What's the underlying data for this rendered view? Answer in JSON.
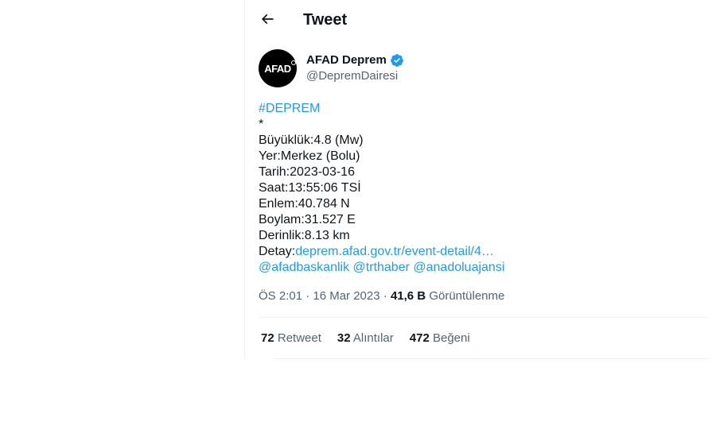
{
  "header": {
    "title": "Tweet",
    "back_icon": "arrow-left-icon"
  },
  "author": {
    "avatar_text": "AFAD",
    "name": "AFAD Deprem",
    "handle": "@DepremDairesi",
    "verified_icon": "verified-badge-icon",
    "verified_color": "#1d9bf0"
  },
  "tweet": {
    "hashtag": "#DEPREM",
    "star": "*",
    "magnitude": "Büyüklük:4.8 (Mw)",
    "location": "Yer:Merkez (Bolu)",
    "date": "Tarih:2023-03-16",
    "time": "Saat:13:55:06 TSİ",
    "latitude": "Enlem:40.784 N",
    "longitude": "Boylam:31.527 E",
    "depth": "Derinlik:8.13 km",
    "detail_label": "Detay:",
    "detail_link": "deprem.afad.gov.tr/event-detail/4…",
    "mentions": [
      "@afadbaskanlik",
      "@trthaber",
      "@anadoluajansi"
    ],
    "link_color": "#1d9bf0"
  },
  "meta": {
    "timestamp": "ÖS 2:01 · 16 Mar 2023",
    "separator": "·",
    "views_count": "41,6 B",
    "views_label": "Görüntülenme"
  },
  "stats": {
    "retweets_count": "72",
    "retweets_label": "Retweet",
    "quotes_count": "32",
    "quotes_label": "Alıntılar",
    "likes_count": "472",
    "likes_label": "Beğeni"
  }
}
